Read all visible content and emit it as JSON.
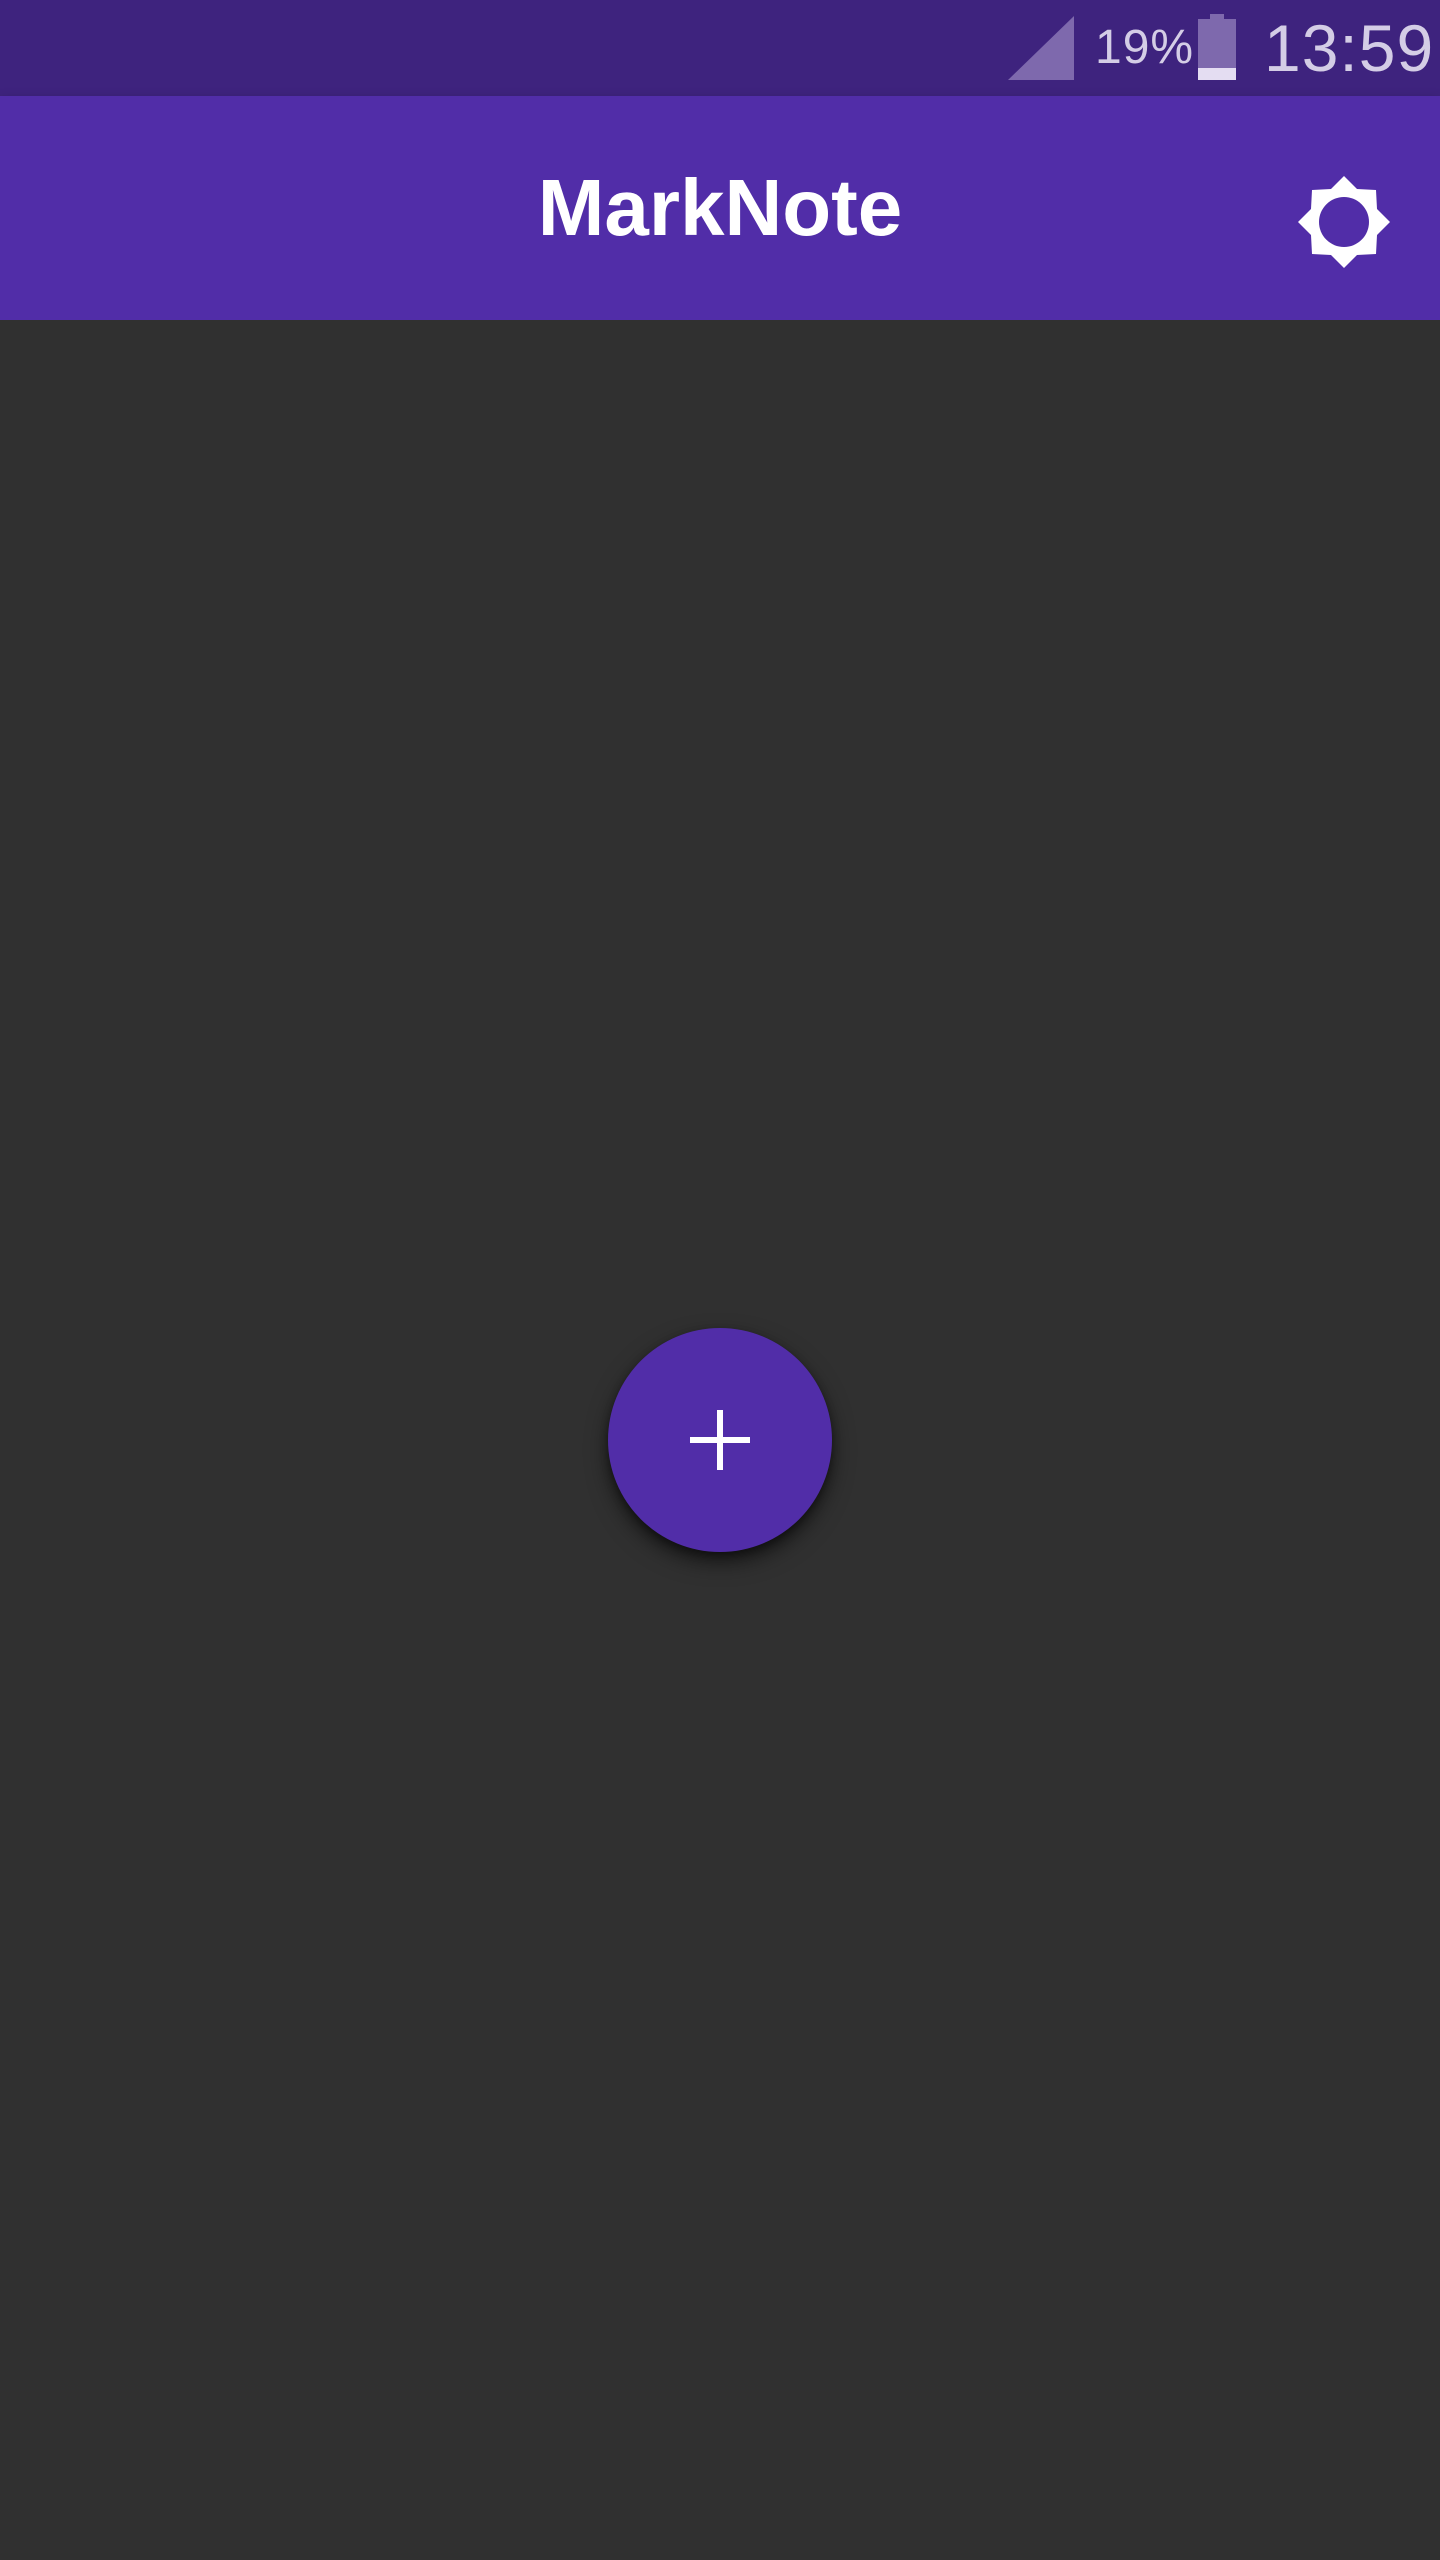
{
  "status_bar": {
    "battery_percent": "19%",
    "battery_level": 0.19,
    "time": "13:59",
    "signal_icon": "cell-signal-icon",
    "battery_icon": "battery-icon"
  },
  "app_bar": {
    "title": "MarkNote",
    "theme_icon": "brightness-icon"
  },
  "fab": {
    "icon": "plus-icon"
  },
  "colors": {
    "status_bar": "#3e237e",
    "primary": "#512da8",
    "background": "#303030",
    "on_primary": "#ffffff",
    "status_text": "#d4cde6"
  }
}
